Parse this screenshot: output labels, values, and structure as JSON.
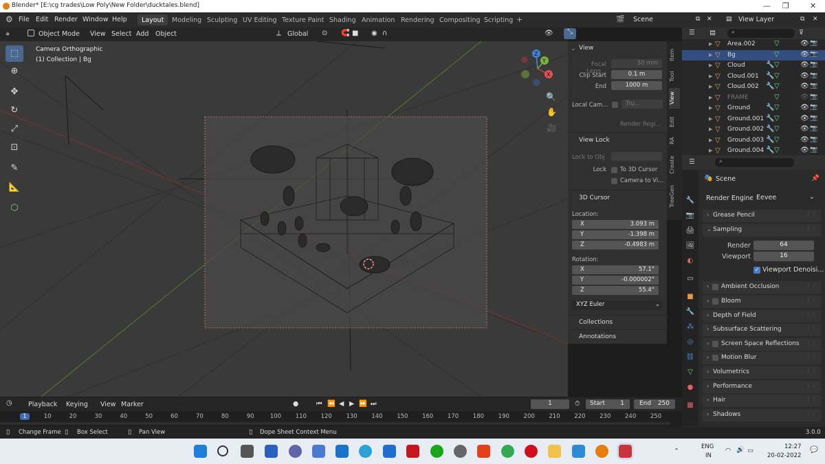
{
  "window": {
    "title": "Blender* [E:\\cg trades\\Low Poly\\New Folder\\ducktales.blend]"
  },
  "menu": {
    "items": [
      "File",
      "Edit",
      "Render",
      "Window",
      "Help"
    ]
  },
  "workspaces": [
    "Layout",
    "Modeling",
    "Sculpting",
    "UV Editing",
    "Texture Paint",
    "Shading",
    "Animation",
    "Rendering",
    "Compositing",
    "Scripting"
  ],
  "workspace_add": "+",
  "scene_name": "Scene",
  "view_layer": "View Layer",
  "viewport_header": {
    "mode": "Object Mode",
    "view": "View",
    "select": "Select",
    "add": "Add",
    "object": "Object",
    "orientation": "Global"
  },
  "viewport_info": {
    "line1": "Camera Orthographic",
    "line2": "(1) Collection | Bg"
  },
  "gizmo": {
    "x": "X",
    "y": "Y",
    "z": "Z"
  },
  "npanel": {
    "tabs": [
      "Item",
      "Tool",
      "View",
      "Edit",
      "RA",
      "Create",
      "TreeGen"
    ],
    "active_tab": "View",
    "view_header": "View",
    "focal_length_label": "Focal Leng...",
    "focal_length": "50 mm",
    "clip_start_label": "Clip Start",
    "clip_start": "0.1 m",
    "end_label": "End",
    "clip_end": "1000 m",
    "local_cam_label": "Local Cam...",
    "local_cam_value": "Tru...",
    "render_region": "Render Regi...",
    "view_lock_header": "View Lock",
    "lock_to_obj_label": "Lock to Obj",
    "lock_label": "Lock",
    "to_3d_cursor": "To 3D Cursor",
    "camera_to_view": "Camera to Vi...",
    "cursor_header": "3D Cursor",
    "location_label": "Location:",
    "loc_x": "3.093 m",
    "loc_y": "-1.398 m",
    "loc_z": "-0.4983 m",
    "rotation_label": "Rotation:",
    "rot_x": "57.1°",
    "rot_y": "-0.000002°",
    "rot_z": "55.4°",
    "rotation_mode": "XYZ Euler",
    "axis_x": "X",
    "axis_y": "Y",
    "axis_z": "Z",
    "collections_header": "Collections",
    "annotations_header": "Annotations"
  },
  "outliner": {
    "rows": [
      {
        "name": "Area.002",
        "selected": false
      },
      {
        "name": "Bg",
        "selected": true
      },
      {
        "name": "Cloud",
        "selected": false
      },
      {
        "name": "Cloud.001",
        "selected": false
      },
      {
        "name": "Cloud.002",
        "selected": false
      },
      {
        "name": "FRAME",
        "selected": false
      },
      {
        "name": "Ground",
        "selected": false
      },
      {
        "name": "Ground.001",
        "selected": false
      },
      {
        "name": "Ground.002",
        "selected": false
      },
      {
        "name": "Ground.003",
        "selected": false
      },
      {
        "name": "Ground.004",
        "selected": false
      }
    ]
  },
  "properties": {
    "scene_label": "Scene",
    "render_engine_label": "Render Engine",
    "render_engine": "Eevee",
    "sections": [
      "Grease Pencil",
      "Sampling",
      "Ambient Occlusion",
      "Bloom",
      "Depth of Field",
      "Subsurface Scattering",
      "Screen Space Reflections",
      "Motion Blur",
      "Volumetrics",
      "Performance",
      "Hair",
      "Shadows"
    ],
    "render_label": "Render",
    "render_samples": "64",
    "viewport_label": "Viewport",
    "viewport_samples": "16",
    "viewport_denoise": "Viewport Denoisi..."
  },
  "timeline": {
    "playback": "Playback",
    "keying": "Keying",
    "view": "View",
    "marker": "Marker",
    "current_frame": "1",
    "start_label": "Start",
    "start": "1",
    "end_label": "End",
    "end": "250",
    "ruler": [
      "1",
      "10",
      "20",
      "30",
      "40",
      "50",
      "60",
      "70",
      "80",
      "90",
      "100",
      "110",
      "120",
      "130",
      "140",
      "150",
      "160",
      "170",
      "180",
      "190",
      "200",
      "210",
      "220",
      "230",
      "240",
      "250"
    ]
  },
  "status": {
    "change_frame": "Change Frame",
    "box_select": "Box Select",
    "pan_view": "Pan View",
    "context_menu": "Dope Sheet Context Menu",
    "version": "3.0.0"
  },
  "taskbar": {
    "lang1": "ENG",
    "lang2": "IN",
    "time": "12:27",
    "date": "20-02-2022"
  }
}
